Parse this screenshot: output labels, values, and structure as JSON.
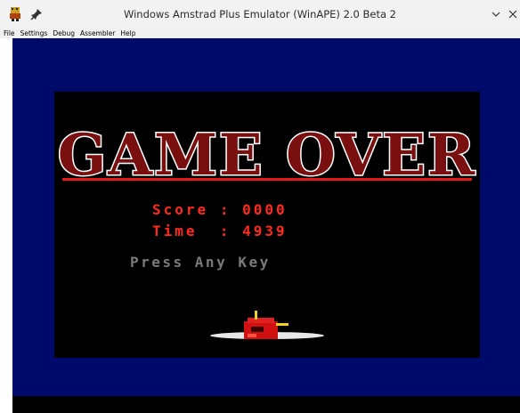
{
  "window": {
    "title": "Windows Amstrad Plus Emulator (WinAPE) 2.0 Beta 2",
    "icons": [
      "app-icon",
      "pin-icon",
      "minimize-icon",
      "close-icon"
    ]
  },
  "menubar": {
    "items": [
      "File",
      "Settings",
      "Debug",
      "Assembler",
      "Help"
    ]
  },
  "game": {
    "logo_text": "GAME OVER",
    "score_label": "Score",
    "score_sep": ":",
    "score_value": "0000",
    "time_label": "Time",
    "time_sep": ":",
    "time_value": "4939",
    "prompt": "Press Any Key"
  },
  "colors": {
    "border_blue": "#000a6b",
    "screen_black": "#000000",
    "logo_fill": "#7a0f0f",
    "logo_outline": "#ffffff",
    "accent_red": "#ff2a1f",
    "prompt_gray": "#7a7a7a"
  }
}
